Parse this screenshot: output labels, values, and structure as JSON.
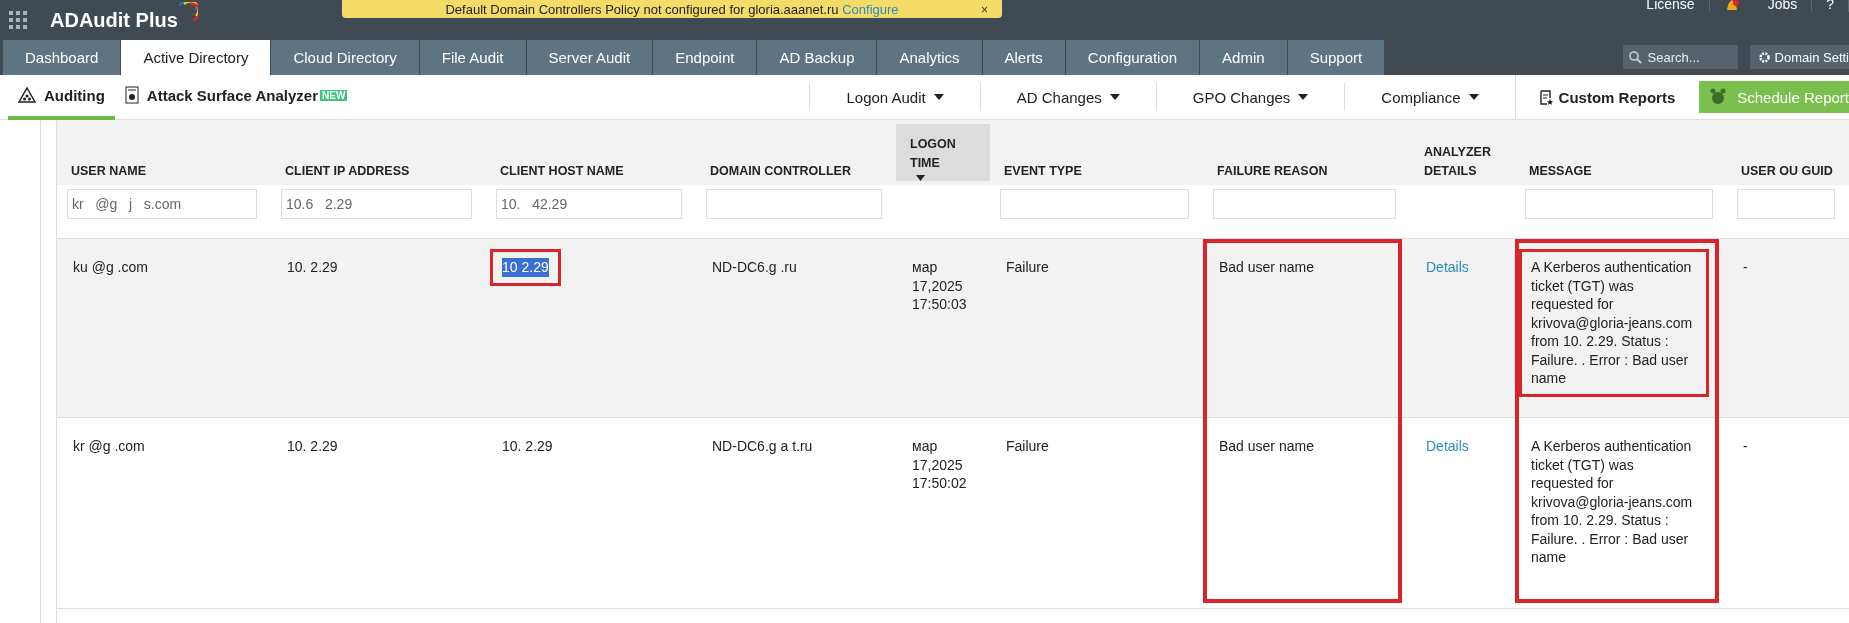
{
  "app": {
    "title": "ADAudit Plus"
  },
  "banner": {
    "text": "Default Domain Controllers Policy not configured for gloria.aaanet.ru",
    "link": "Configure",
    "close": "×"
  },
  "top_links": [
    {
      "kind": "text",
      "label": "License"
    },
    {
      "kind": "bell"
    },
    {
      "kind": "text",
      "label": "Jobs"
    },
    {
      "kind": "text",
      "label": "?"
    }
  ],
  "tabs": [
    {
      "label": "Dashboard",
      "selected": false
    },
    {
      "label": "Active Directory",
      "selected": true
    },
    {
      "label": "Cloud Directory",
      "selected": false
    },
    {
      "label": "File Audit",
      "selected": false
    },
    {
      "label": "Server Audit",
      "selected": false
    },
    {
      "label": "Endpoint",
      "selected": false
    },
    {
      "label": "AD Backup",
      "selected": false
    },
    {
      "label": "Analytics",
      "selected": false
    },
    {
      "label": "Alerts",
      "selected": false
    },
    {
      "label": "Configuration",
      "selected": false
    },
    {
      "label": "Admin",
      "selected": false
    },
    {
      "label": "Support",
      "selected": false
    }
  ],
  "search": {
    "placeholder": "Search..."
  },
  "domain_settings": "Domain Setti",
  "subnav": {
    "items": [
      {
        "kind": "auditing",
        "label": "Auditing",
        "selected": true
      },
      {
        "kind": "analyzer",
        "label": "Attack Surface Analyzer",
        "badge": "NEW",
        "selected": false
      }
    ],
    "menus": [
      "Logon Audit",
      "AD Changes",
      "GPO Changes",
      "Compliance"
    ],
    "custom_reports": "Custom Reports",
    "schedule": "Schedule Report"
  },
  "table": {
    "columns": [
      {
        "label": "USER NAME",
        "has_filter": true,
        "filter": "kr   @g   j   s.com",
        "sorted": false,
        "outlined": false
      },
      {
        "label": "CLIENT IP ADDRESS",
        "has_filter": true,
        "filter": "10.6   2.29",
        "sorted": false,
        "outlined": false
      },
      {
        "label": "CLIENT HOST NAME",
        "has_filter": true,
        "filter": "10.   42.29",
        "sorted": false,
        "outlined": false
      },
      {
        "label": "DOMAIN CONTROLLER",
        "has_filter": true,
        "sorted": false,
        "outlined": false
      },
      {
        "label": "LOGON TIME",
        "has_filter": false,
        "sorted": true,
        "outlined": false
      },
      {
        "label": "EVENT TYPE",
        "has_filter": true,
        "sorted": false,
        "outlined": false
      },
      {
        "label": "FAILURE REASON",
        "has_filter": true,
        "sorted": false,
        "outlined": true
      },
      {
        "label": "ANALYZER DETAILS",
        "has_filter": false,
        "sorted": false,
        "outlined": false
      },
      {
        "label": "MESSAGE",
        "has_filter": true,
        "sorted": false,
        "outlined": true
      },
      {
        "label": "USER OU GUID",
        "has_filter": true,
        "sorted": false,
        "outlined": false
      }
    ],
    "rows": [
      {
        "hovered": true,
        "cells": [
          {
            "kind": "text",
            "text": "ku   @g   .com",
            "selected": false,
            "outlined": false
          },
          {
            "kind": "text",
            "text": "10.   2.29",
            "selected": false,
            "outlined": false
          },
          {
            "kind": "text",
            "text": "10   2.29",
            "selected": true,
            "outlined": true
          },
          {
            "kind": "text",
            "text": "ND-DC6.g   .ru",
            "selected": false,
            "outlined": false
          },
          {
            "kind": "text",
            "text": "мар 17,2025 17:50:03",
            "selected": false,
            "outlined": false
          },
          {
            "kind": "text",
            "text": "Failure",
            "selected": false,
            "outlined": false
          },
          {
            "kind": "text",
            "text": "Bad user name",
            "selected": false,
            "outlined": false
          },
          {
            "kind": "link",
            "text": "Details",
            "selected": false,
            "outlined": false
          },
          {
            "kind": "text",
            "text": "A Kerberos authentication ticket (TGT) was requested for krivova@gloria-jeans.com from 10.   2.29. Status : Failure. . Error : Bad user name",
            "selected": false,
            "outlined": true
          },
          {
            "kind": "text",
            "text": "-",
            "selected": false,
            "outlined": false
          }
        ]
      },
      {
        "hovered": false,
        "cells": [
          {
            "kind": "text",
            "text": "kr   @g   .com",
            "selected": false,
            "outlined": false
          },
          {
            "kind": "text",
            "text": "10.   2.29",
            "selected": false,
            "outlined": false
          },
          {
            "kind": "text",
            "text": "10.   2.29",
            "selected": false,
            "outlined": false
          },
          {
            "kind": "text",
            "text": "ND-DC6.g   a   t.ru",
            "selected": false,
            "outlined": false
          },
          {
            "kind": "text",
            "text": "мар 17,2025 17:50:02",
            "selected": false,
            "outlined": false
          },
          {
            "kind": "text",
            "text": "Failure",
            "selected": false,
            "outlined": false
          },
          {
            "kind": "text",
            "text": "Bad user name",
            "selected": false,
            "outlined": false
          },
          {
            "kind": "link",
            "text": "Details",
            "selected": false,
            "outlined": false
          },
          {
            "kind": "text",
            "text": "A Kerberos authentication ticket (TGT) was requested for krivova@gloria-jeans.com from 10.   2.29. Status : Failure. . Error : Bad user name",
            "selected": false,
            "outlined": false
          },
          {
            "kind": "text",
            "text": "-",
            "selected": false,
            "outlined": false
          }
        ]
      }
    ]
  }
}
